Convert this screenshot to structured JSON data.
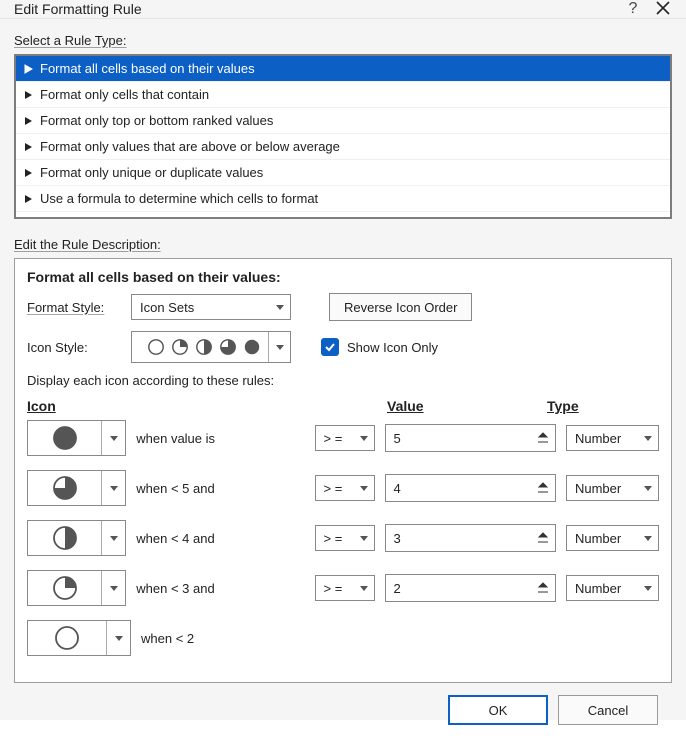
{
  "window": {
    "title": "Edit Formatting Rule"
  },
  "sections": {
    "select_label": "Select a Rule Type:",
    "edit_label": "Edit the Rule Description:"
  },
  "rule_types": [
    "Format all cells based on their values",
    "Format only cells that contain",
    "Format only top or bottom ranked values",
    "Format only values that are above or below average",
    "Format only unique or duplicate values",
    "Use a formula to determine which cells to format"
  ],
  "desc": {
    "heading": "Format all cells based on their values:",
    "format_style_label": "Format Style:",
    "format_style_value": "Icon Sets",
    "reverse_button": "Reverse Icon Order",
    "icon_style_label": "Icon Style:",
    "show_icon_only": "Show Icon Only",
    "subtitle": "Display each icon according to these rules:",
    "headers": {
      "icon": "Icon",
      "value": "Value",
      "type": "Type"
    }
  },
  "rules": [
    {
      "fill": 100,
      "when": "when value is",
      "op": "> =",
      "value": "5",
      "type": "Number"
    },
    {
      "fill": 75,
      "when": "when < 5 and",
      "op": "> =",
      "value": "4",
      "type": "Number"
    },
    {
      "fill": 50,
      "when": "when < 4 and",
      "op": "> =",
      "value": "3",
      "type": "Number"
    },
    {
      "fill": 25,
      "when": "when < 3 and",
      "op": "> =",
      "value": "2",
      "type": "Number"
    },
    {
      "fill": 0,
      "when": "when < 2",
      "op": "",
      "value": "",
      "type": ""
    }
  ],
  "footer": {
    "ok": "OK",
    "cancel": "Cancel"
  }
}
